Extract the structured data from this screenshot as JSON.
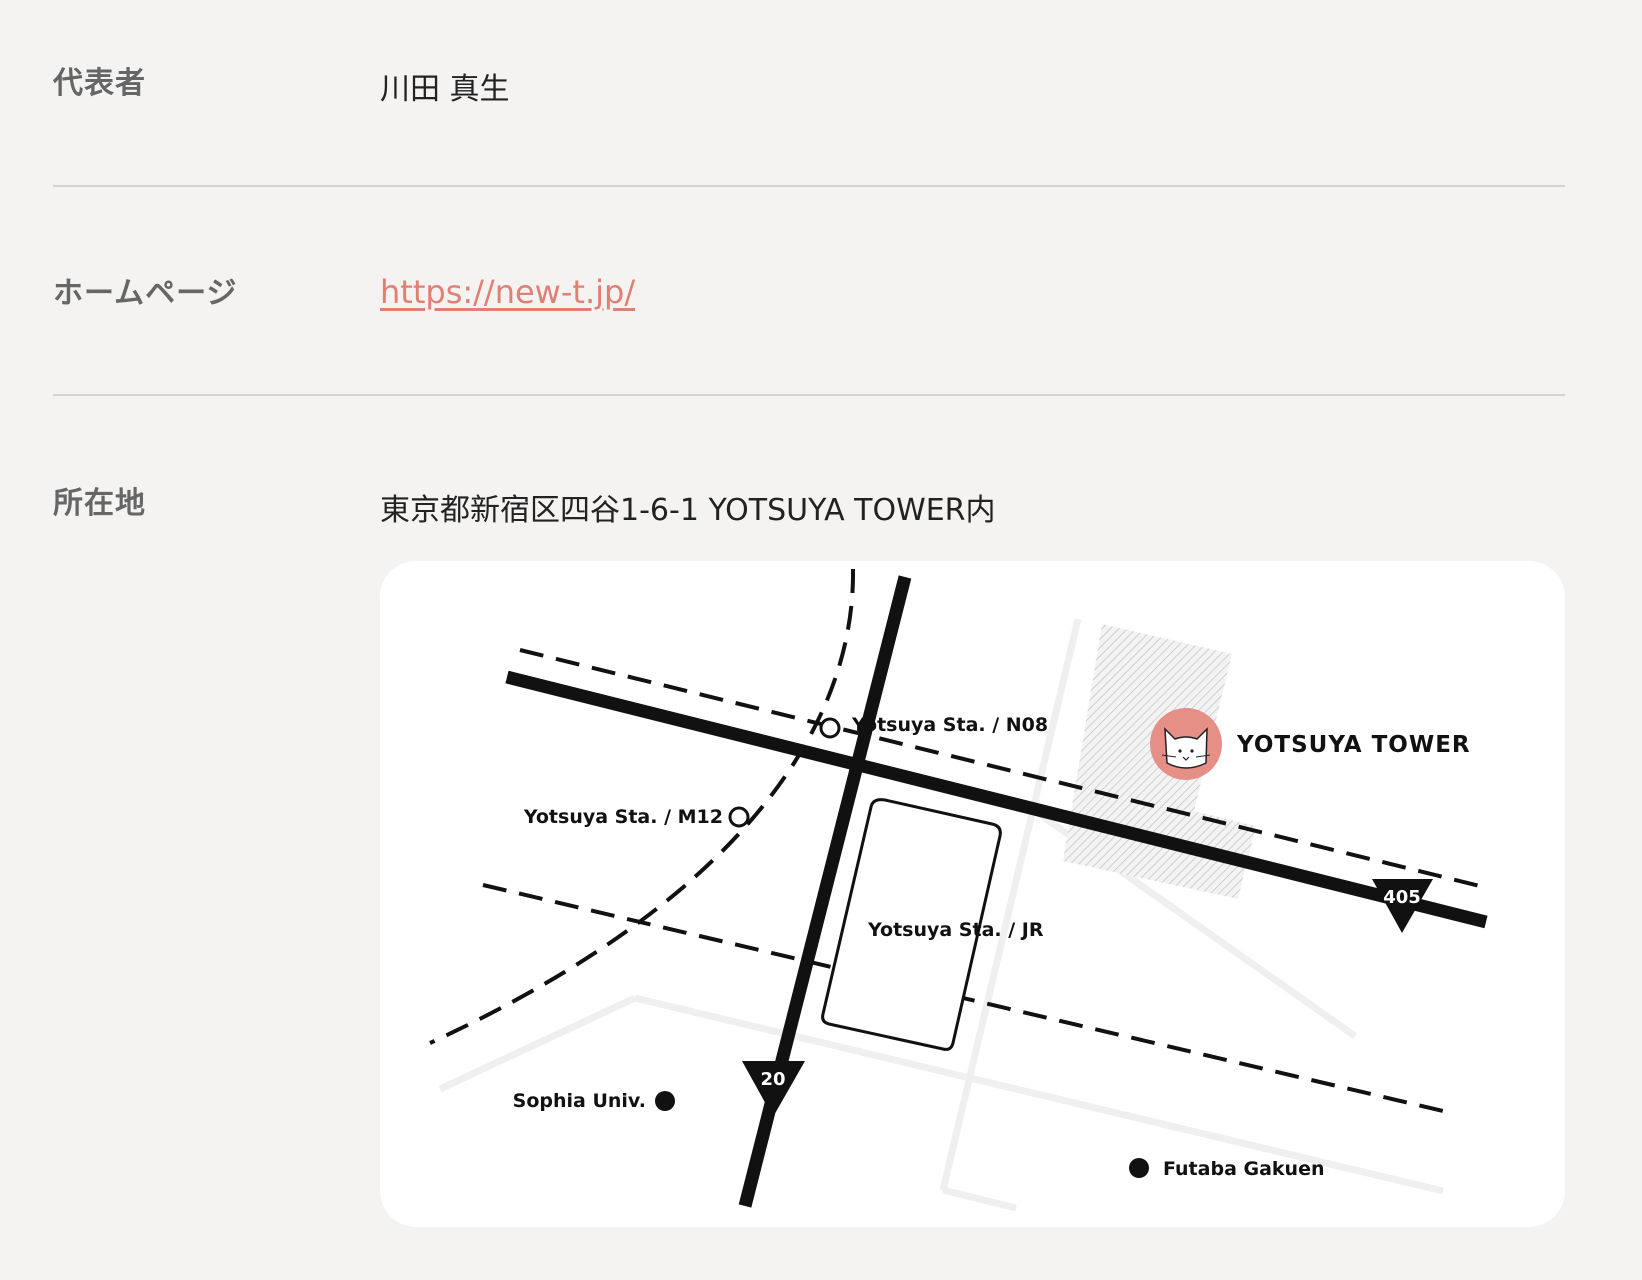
{
  "rows": [
    {
      "label": "代表者",
      "value": "川田 真生"
    },
    {
      "label": "ホームページ",
      "link": "https://new-t.jp/"
    },
    {
      "label": "所在地",
      "value": "東京都新宿区四谷1-6-1 YOTSUYA TOWER内"
    }
  ],
  "map": {
    "labels": {
      "n08": "Yotsuya Sta. / N08",
      "m12": "Yotsuya Sta. / M12",
      "jr": "Yotsuya Sta. / JR",
      "tower": "YOTSUYA TOWER",
      "sophia": "Sophia Univ.",
      "futaba": "Futaba Gakuen"
    },
    "routes": {
      "r405": "405",
      "r20": "20"
    },
    "colors": {
      "accent": "#e07f73",
      "road": "#111111",
      "minor_road": "#efefef"
    }
  }
}
